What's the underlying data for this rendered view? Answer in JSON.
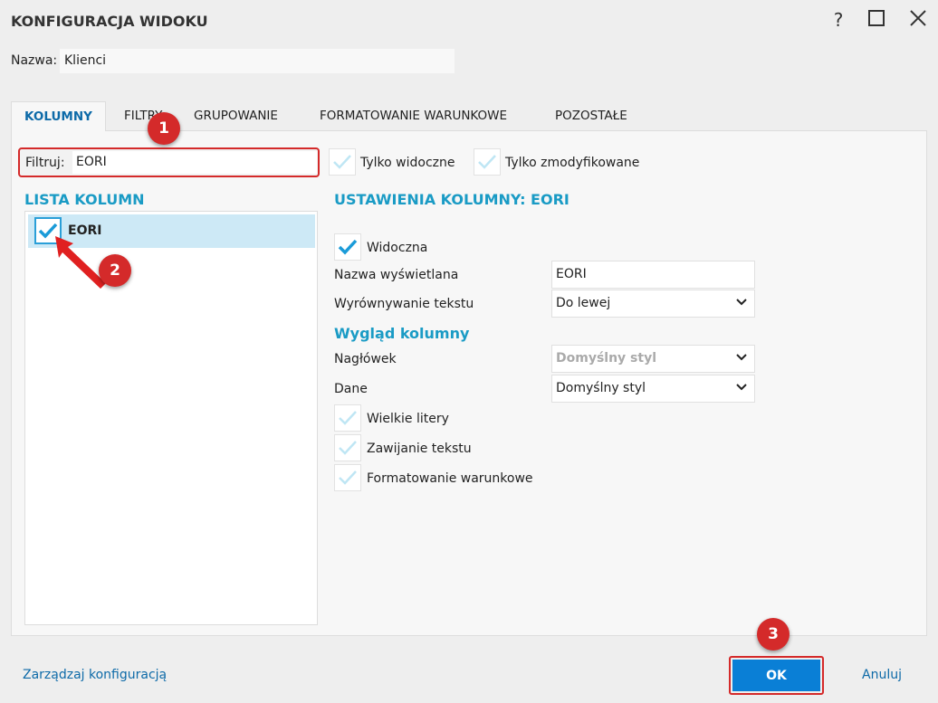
{
  "window": {
    "title": "KONFIGURACJA WIDOKU",
    "help": "?"
  },
  "name": {
    "label": "Nazwa:",
    "value": "Klienci"
  },
  "tabs": [
    {
      "label": "KOLUMNY",
      "active": true
    },
    {
      "label": "FILTRY"
    },
    {
      "label": "GRUPOWANIE"
    },
    {
      "label": "FORMATOWANIE WARUNKOWE"
    },
    {
      "label": "POZOSTAŁE"
    }
  ],
  "filter": {
    "label": "Filtruj:",
    "value": "EORI",
    "only_visible": "Tylko widoczne",
    "only_visible_checked": false,
    "only_modified": "Tylko zmodyfikowane",
    "only_modified_checked": false
  },
  "column_list": {
    "heading": "LISTA KOLUMN",
    "items": [
      {
        "label": "EORI",
        "checked": true
      }
    ]
  },
  "settings": {
    "heading": "USTAWIENIA KOLUMNY: EORI",
    "visible_label": "Widoczna",
    "visible_checked": true,
    "display_name_label": "Nazwa wyświetlana",
    "display_name_value": "EORI",
    "align_label": "Wyrównywanie tekstu",
    "align_value": "Do lewej",
    "appearance_heading": "Wygląd kolumny",
    "header_label": "Nagłówek",
    "header_value": "Domyślny styl",
    "data_label": "Dane",
    "data_value": "Domyślny styl",
    "uppercase": "Wielkie litery",
    "wrap": "Zawijanie tekstu",
    "conditional": "Formatowanie warunkowe"
  },
  "footer": {
    "manage": "Zarządzaj konfiguracją",
    "ok": "OK",
    "cancel": "Anuluj"
  },
  "annotations": [
    "1",
    "2",
    "3"
  ],
  "colors": {
    "accent": "#1a9bc5",
    "ok": "#0a7fd6",
    "annotation": "#d42a2a",
    "selected_row": "#cde9f6"
  }
}
